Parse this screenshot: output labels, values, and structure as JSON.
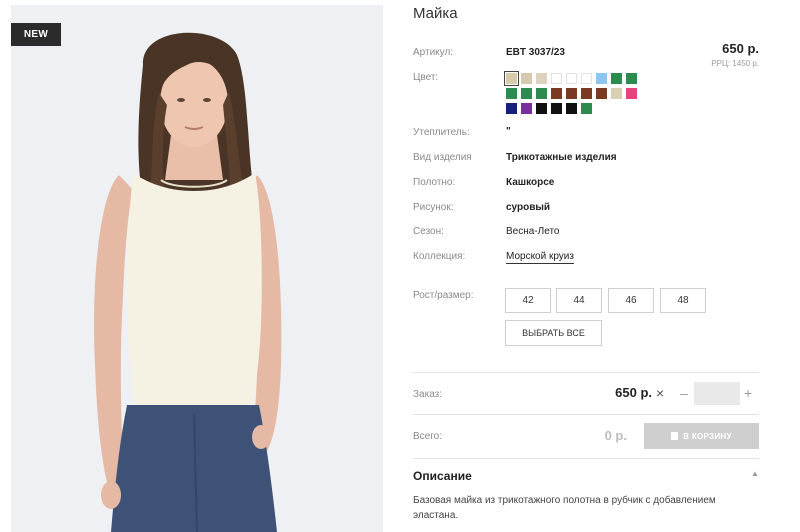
{
  "product": {
    "badge": "NEW",
    "title": "Майка",
    "price": "650 р.",
    "rrp": "РРЦ: 1450 р."
  },
  "attributes": {
    "article_label": "Артикул:",
    "article_value": "EBT 3037/23",
    "color_label": "Цвет:",
    "insulation_label": "Утеплитель:",
    "insulation_value": "\"",
    "type_label": "Вид изделия",
    "type_value": "Трикотажные изделия",
    "fabric_label": "Полотно:",
    "fabric_value": "Кашкорсе",
    "pattern_label": "Рисунок:",
    "pattern_value": "суровый",
    "season_label": "Сезон:",
    "season_value": "Весна-Лето",
    "collection_label": "Коллекция:",
    "collection_value": "Морской круиз",
    "size_label": "Рост/размер:"
  },
  "color_swatches": [
    "#d8cbaa",
    "#d5cab0",
    "#dcd2bd",
    "#ffffff",
    "#ffffff",
    "#ffffff",
    "#8ec6ef",
    "#2e8b4f",
    "#2e8b4f",
    "#2e8b4f",
    "#2e8b4f",
    "#2e8b4f",
    "#7a3a22",
    "#7a3a22",
    "#7a3a22",
    "#7a3a22",
    "#d9cfb2",
    "#e8417d",
    "#15207a",
    "#7a2f9e",
    "#101010",
    "#101010",
    "#101010",
    "#2e8b4f"
  ],
  "sizes": [
    "42",
    "44",
    "46",
    "48"
  ],
  "select_all": "ВЫБРАТЬ ВСЕ",
  "order": {
    "label": "Заказ:",
    "price": "650 р.",
    "remove": "×",
    "minus": "–",
    "quantity": "",
    "plus": "+"
  },
  "total": {
    "label": "Всего:",
    "value": "0 р.",
    "cart_button": "В КОРЗИНУ"
  },
  "description": {
    "heading": "Описание",
    "toggle": "▲",
    "text": "Базовая майка из трикотажного полотна в рубчик с добавлением эластана."
  }
}
